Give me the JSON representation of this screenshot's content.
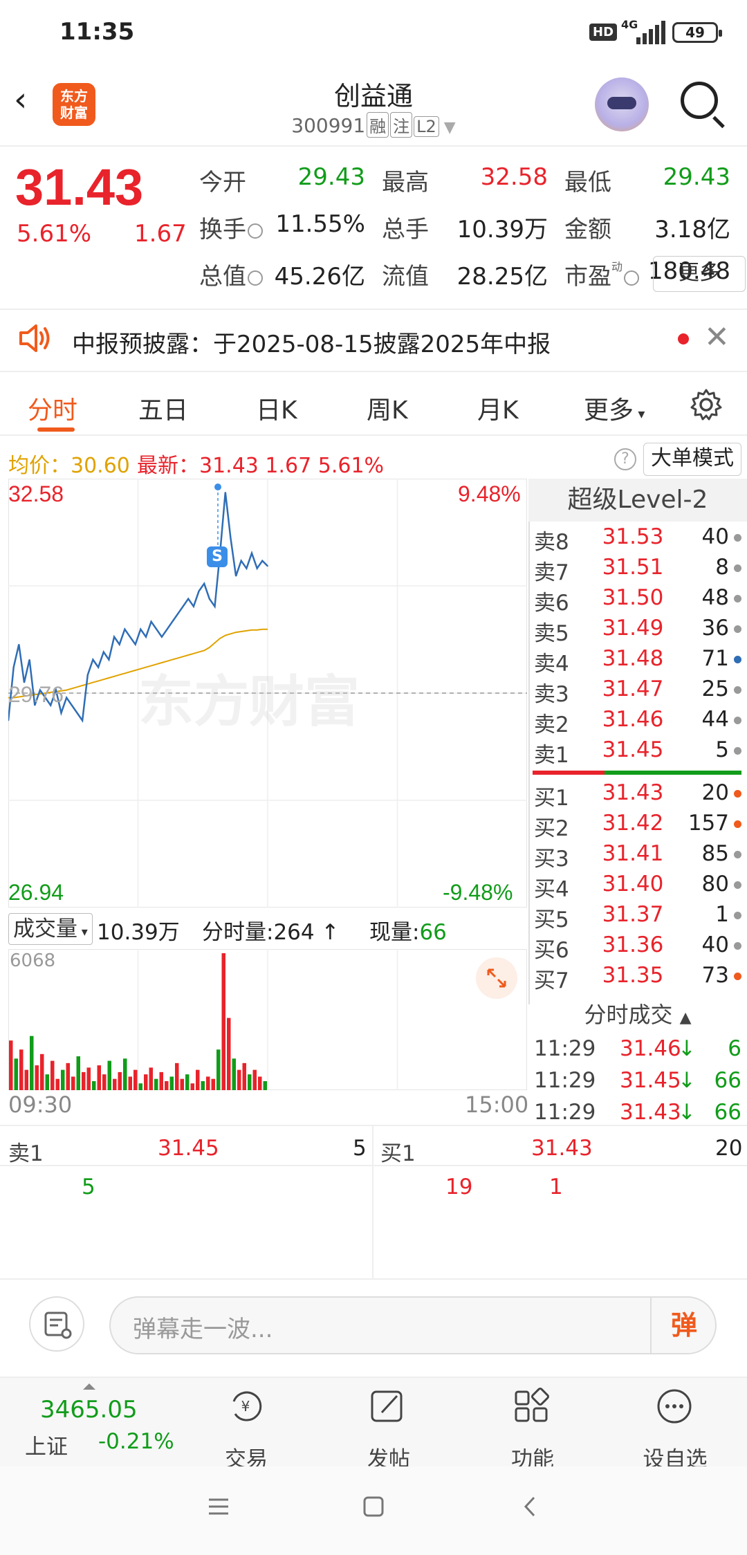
{
  "status_bar": {
    "time": "11:35",
    "hd": "HD",
    "network": "4G",
    "battery": "49"
  },
  "header": {
    "back_icon": "chevron-left-icon",
    "logo_text": [
      "东方",
      "财富"
    ],
    "title": "创益通",
    "code": "300991",
    "tags": [
      "融",
      "注",
      "L2"
    ]
  },
  "quote": {
    "price": "31.43",
    "change_pct": "5.61%",
    "change_amt": "1.67",
    "rows": [
      [
        {
          "label": "今开",
          "value": "29.43",
          "color": "green"
        },
        {
          "label": "最高",
          "value": "32.58",
          "color": "red"
        },
        {
          "label": "最低",
          "value": "29.43",
          "color": "green"
        }
      ],
      [
        {
          "label": "换手",
          "value": "11.55%",
          "color": "black"
        },
        {
          "label": "总手",
          "value": "10.39万",
          "color": "black"
        },
        {
          "label": "金额",
          "value": "3.18亿",
          "color": "black"
        }
      ],
      [
        {
          "label": "总值",
          "value": "45.26亿",
          "color": "black"
        },
        {
          "label": "流值",
          "value": "28.25亿",
          "color": "black"
        },
        {
          "label": "市盈",
          "value": "180.48",
          "color": "black"
        }
      ]
    ],
    "pe_sup": "动",
    "more_label": "更多"
  },
  "notice": {
    "text": "中报预披露：于2025-08-15披露2025年中报",
    "close": "✕"
  },
  "tabs": {
    "items": [
      "分时",
      "五日",
      "日K",
      "周K",
      "月K",
      "更多"
    ],
    "active": "分时"
  },
  "info": {
    "avg_label": "均价：30.60",
    "latest_label": "最新：31.43  1.67  5.61%",
    "help": "?",
    "big_mode": "大单模式"
  },
  "chart": {
    "y_top": "32.58",
    "y_bottom": "26.94",
    "y_mid": "29.76",
    "pct_top": "9.48%",
    "pct_bottom": "-9.48%",
    "watermark": "东方财富",
    "marker": "S",
    "x_start": "09:30",
    "x_end": "15:00"
  },
  "chart_data": {
    "type": "line",
    "title": "",
    "xlabel": "",
    "ylabel": "",
    "ylim": [
      26.94,
      32.58
    ],
    "series": [
      {
        "values": [
          29.4,
          30.1,
          30.4,
          29.9,
          30.2,
          29.6,
          29.8,
          29.7,
          29.6,
          29.8,
          29.5,
          29.7,
          29.6,
          29.5,
          29.4,
          30.0,
          30.2,
          30.1,
          30.3,
          30.2,
          30.5,
          30.4,
          30.6,
          30.5,
          30.4,
          30.6,
          30.5,
          30.7,
          30.6,
          30.5,
          30.6,
          30.7,
          30.8,
          30.9,
          31.0,
          30.9,
          31.1,
          31.2,
          31.0,
          30.9,
          31.6,
          32.4,
          31.8,
          31.3,
          31.5,
          31.4,
          31.6,
          31.4,
          31.5,
          31.43
        ]
      },
      {
        "values": [
          29.7,
          29.7,
          29.71,
          29.72,
          29.73,
          29.74,
          29.75,
          29.76,
          29.77,
          29.78,
          29.79,
          29.8,
          29.82,
          29.84,
          29.86,
          29.88,
          29.9,
          29.92,
          29.94,
          29.96,
          29.98,
          30.0,
          30.02,
          30.04,
          30.06,
          30.08,
          30.1,
          30.12,
          30.14,
          30.16,
          30.18,
          30.2,
          30.22,
          30.24,
          30.26,
          30.28,
          30.3,
          30.32,
          30.36,
          30.42,
          30.48,
          30.52,
          30.54,
          30.56,
          30.57,
          30.58,
          30.59,
          30.59,
          30.6,
          30.6
        ]
      }
    ],
    "volume_max": "6068",
    "volume": [
      2200,
      1400,
      1800,
      900,
      2400,
      1100,
      1600,
      700,
      1300,
      500,
      900,
      1200,
      600,
      1500,
      800,
      1000,
      400,
      1100,
      700,
      1300,
      500,
      800,
      1400,
      600,
      900,
      300,
      700,
      1000,
      500,
      800,
      400,
      600,
      1200,
      500,
      700,
      300,
      900,
      400,
      600,
      500,
      1800,
      6068,
      3200,
      1400,
      900,
      1200,
      700,
      900,
      600,
      400
    ]
  },
  "volume": {
    "selector": "成交量",
    "total": "10.39万",
    "minute_label": "分时量:264",
    "now_label": "现量:",
    "now_value": "66"
  },
  "book": {
    "title": "超级Level-2",
    "asks": [
      {
        "name": "卖8",
        "price": "31.53",
        "vol": "40",
        "dot": "gray"
      },
      {
        "name": "卖7",
        "price": "31.51",
        "vol": "8",
        "dot": "gray"
      },
      {
        "name": "卖6",
        "price": "31.50",
        "vol": "48",
        "dot": "gray"
      },
      {
        "name": "卖5",
        "price": "31.49",
        "vol": "36",
        "dot": "gray"
      },
      {
        "name": "卖4",
        "price": "31.48",
        "vol": "71",
        "dot": "blue"
      },
      {
        "name": "卖3",
        "price": "31.47",
        "vol": "25",
        "dot": "gray"
      },
      {
        "name": "卖2",
        "price": "31.46",
        "vol": "44",
        "dot": "gray"
      },
      {
        "name": "卖1",
        "price": "31.45",
        "vol": "5",
        "dot": "gray"
      }
    ],
    "bids": [
      {
        "name": "买1",
        "price": "31.43",
        "vol": "20",
        "dot": "orange"
      },
      {
        "name": "买2",
        "price": "31.42",
        "vol": "157",
        "dot": "orange"
      },
      {
        "name": "买3",
        "price": "31.41",
        "vol": "85",
        "dot": "gray"
      },
      {
        "name": "买4",
        "price": "31.40",
        "vol": "80",
        "dot": "gray"
      },
      {
        "name": "买5",
        "price": "31.37",
        "vol": "1",
        "dot": "gray"
      },
      {
        "name": "买6",
        "price": "31.36",
        "vol": "40",
        "dot": "gray"
      },
      {
        "name": "买7",
        "price": "31.35",
        "vol": "73",
        "dot": "orange"
      }
    ],
    "trades_title": "分时成交",
    "trades": [
      {
        "time": "11:29",
        "price": "31.46",
        "arrow": "↓",
        "vol": "6"
      },
      {
        "time": "11:29",
        "price": "31.45",
        "arrow": "↓",
        "vol": "66"
      },
      {
        "time": "11:29",
        "price": "31.43",
        "arrow": "↓",
        "vol": "66"
      }
    ]
  },
  "queue": {
    "sell_label": "卖1",
    "sell_price": "31.45",
    "sell_vol": "5",
    "sell_orders": [
      "5"
    ],
    "buy_label": "买1",
    "buy_price": "31.43",
    "buy_vol": "20",
    "buy_orders": [
      "19",
      "1"
    ]
  },
  "comment": {
    "placeholder": "弹幕走一波...",
    "dan": "弹"
  },
  "bottom_nav": {
    "index_value": "3465.05",
    "index_name": "上证",
    "index_change": "-0.21%",
    "items": [
      {
        "label": "交易",
        "icon": "trade-icon"
      },
      {
        "label": "发帖",
        "icon": "post-icon"
      },
      {
        "label": "功能",
        "icon": "apps-icon"
      },
      {
        "label": "设自选",
        "icon": "more-icon"
      }
    ]
  },
  "colors": {
    "up": "#e8232b",
    "down": "#119c1a",
    "brand": "#f05a1c",
    "avg": "#e0a200",
    "line": "#2f6db5"
  }
}
